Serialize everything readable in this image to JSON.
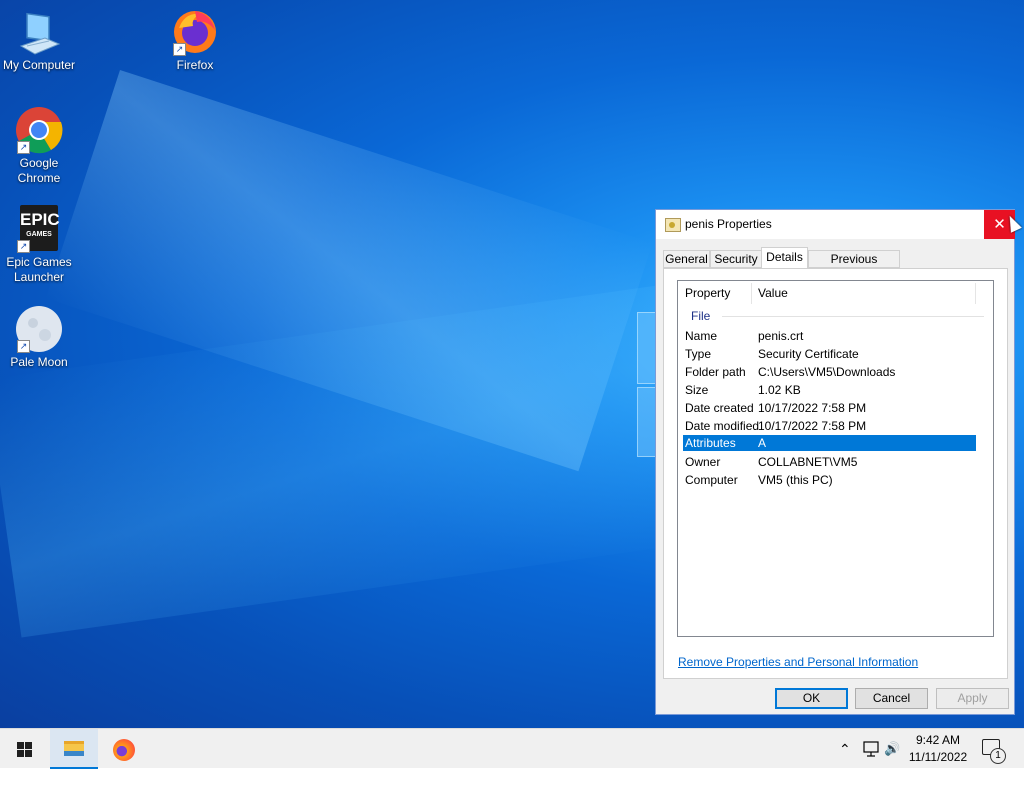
{
  "desktop": {
    "icons": [
      {
        "label": "My Computer"
      },
      {
        "label": "Firefox"
      },
      {
        "label": "Google Chrome"
      },
      {
        "label": "Epic Games Launcher"
      },
      {
        "label": "Pale Moon"
      }
    ],
    "epic_logo": {
      "line1": "EPIC",
      "line2": "GAMES"
    }
  },
  "dialog": {
    "title": "penis Properties",
    "close_glyph": "✕",
    "tabs": [
      {
        "label": "General"
      },
      {
        "label": "Security"
      },
      {
        "label": "Details",
        "active": true
      },
      {
        "label": "Previous Versions"
      }
    ],
    "columns": {
      "property": "Property",
      "value": "Value"
    },
    "group": "File",
    "rows": [
      {
        "property": "Name",
        "value": "penis.crt"
      },
      {
        "property": "Type",
        "value": "Security Certificate"
      },
      {
        "property": "Folder path",
        "value": "C:\\Users\\VM5\\Downloads"
      },
      {
        "property": "Size",
        "value": "1.02 KB"
      },
      {
        "property": "Date created",
        "value": "10/17/2022 7:58 PM"
      },
      {
        "property": "Date modified",
        "value": "10/17/2022 7:58 PM"
      },
      {
        "property": "Attributes",
        "value": "A",
        "selected": true
      },
      {
        "property": "Owner",
        "value": "COLLABNET\\VM5"
      },
      {
        "property": "Computer",
        "value": "VM5 (this PC)"
      }
    ],
    "remove_link": "Remove Properties and Personal Information",
    "buttons": {
      "ok": "OK",
      "cancel": "Cancel",
      "apply": "Apply"
    }
  },
  "taskbar": {
    "clock_time": "9:42 AM",
    "clock_date": "11/11/2022",
    "tray_chevron": "⌃",
    "volume_glyph": "🔊",
    "notification_count": "1"
  },
  "colors": {
    "selection": "#0078d7",
    "close": "#e81123",
    "link": "#0066cc"
  }
}
